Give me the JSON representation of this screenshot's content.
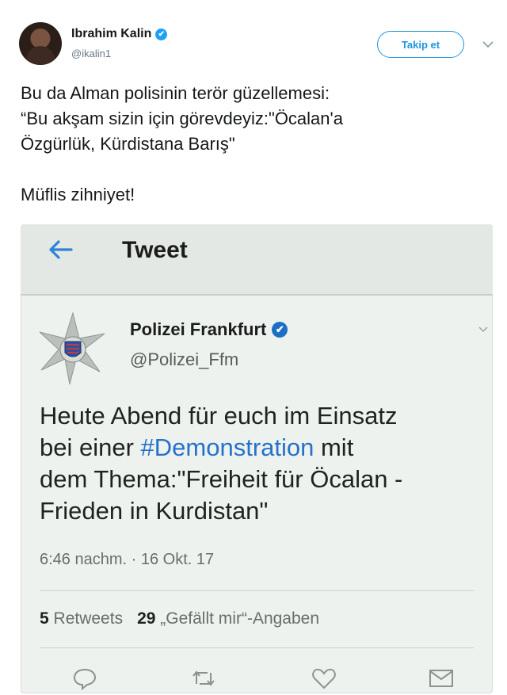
{
  "author": {
    "name": "Ibrahim Kalin",
    "handle": "@ikalin1",
    "follow_label": "Takip et"
  },
  "tweet": {
    "line1": "Bu da Alman polisinin terör güzellemesi:",
    "line2": "“Bu akşam sizin için görevdeyiz:\"Öcalan'a",
    "line3": "Özgürlük, Kürdistana Barış\"",
    "line4": "Müflis zihniyet!"
  },
  "embedded": {
    "bar_title": "Tweet",
    "account_name": "Polizei Frankfurt",
    "account_handle": "@Polizei_Ffm",
    "text_line1": "Heute Abend für euch im Einsatz",
    "text_line2_pre": "bei einer ",
    "text_hashtag": "#Demonstration",
    "text_line2_post": " mit",
    "text_line3": "dem Thema:\"Freiheit für Öcalan -",
    "text_line4": "Frieden in Kurdistan\"",
    "timestamp": "6:46 nachm. · 16 Okt. 17",
    "retweets_count": "5",
    "retweets_label": "Retweets",
    "likes_count": "29",
    "likes_label": "„Gefällt mir“-Angaben"
  },
  "colors": {
    "accent": "#1b95e0",
    "hashtag": "#2672c8"
  },
  "icons": [
    "verified-badge-icon",
    "chevron-down-icon",
    "back-arrow-icon",
    "reply-icon",
    "retweet-icon",
    "like-icon",
    "message-icon"
  ]
}
